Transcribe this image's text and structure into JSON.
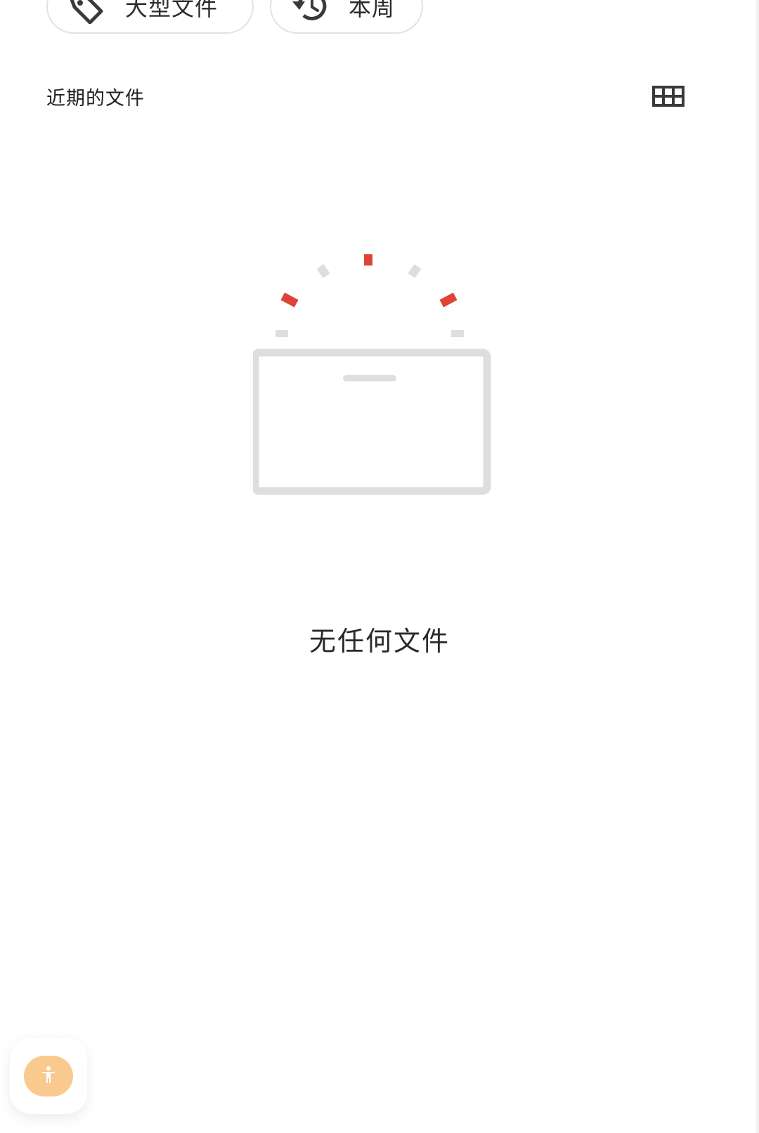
{
  "chips": [
    {
      "label": "大型文件",
      "icon": "tag-icon"
    },
    {
      "label": "本周",
      "icon": "history-icon"
    }
  ],
  "section": {
    "title": "近期的文件",
    "view_toggle_icon": "grid-view-icon"
  },
  "empty_state": {
    "icon": "empty-box-icon",
    "message": "无任何文件"
  },
  "accessibility": {
    "icon": "accessibility-icon"
  },
  "colors": {
    "accent": "#db4437",
    "chip_border": "#e2e2e2",
    "illustration_gray": "#dedede",
    "a11y_button": "#f9c98d"
  }
}
